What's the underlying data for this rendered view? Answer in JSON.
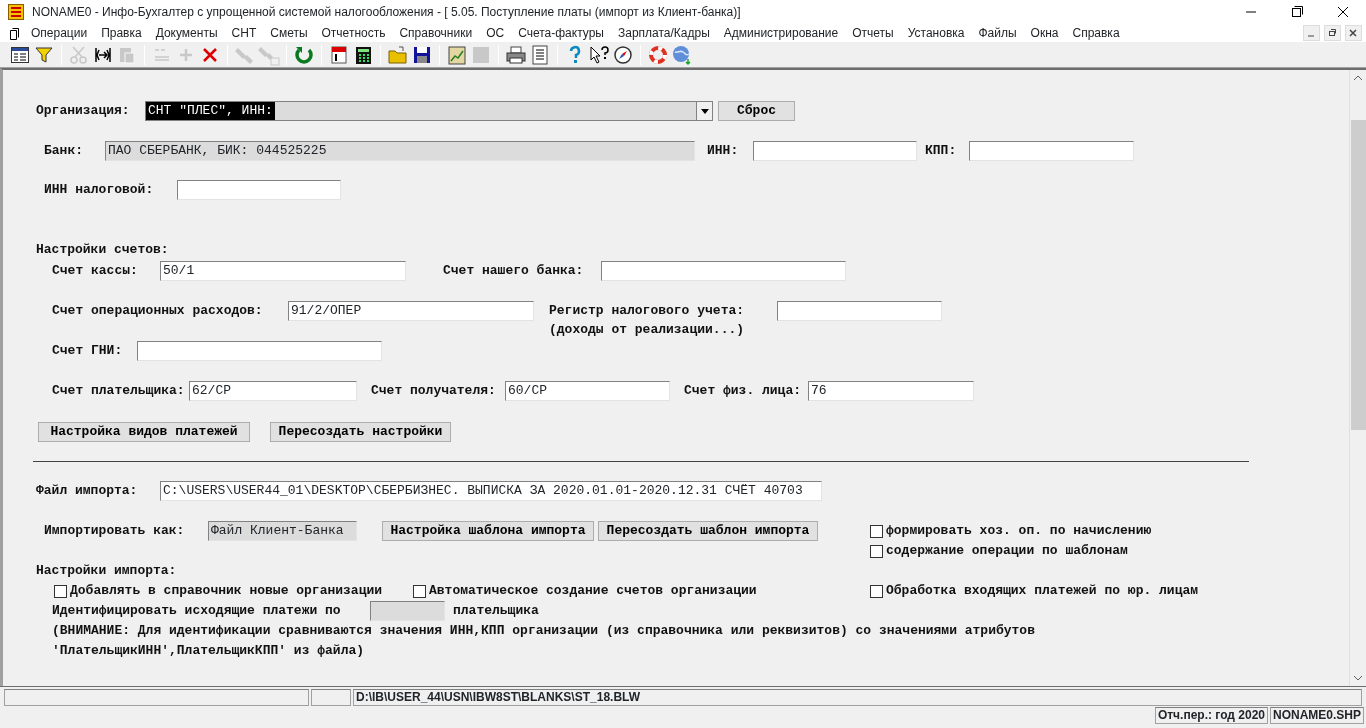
{
  "window": {
    "title": "NONAME0 - Инфо-Бухгалтер с упрощенной системой налогообложения - [ 5.05. Поступление платы (импорт из Клиент-банка)]"
  },
  "menu": [
    "Операции",
    "Правка",
    "Документы",
    "СНТ",
    "Сметы",
    "Отчетность",
    "Справочники",
    "ОС",
    "Счета-фактуры",
    "Зарплата/Кадры",
    "Администрирование",
    "Отчеты",
    "Установка",
    "Файлы",
    "Окна",
    "Справка"
  ],
  "toolbar": [
    [
      {
        "disabled": false
      },
      {
        "disabled": false
      }
    ],
    [
      {
        "disabled": true
      },
      {
        "disabled": false
      },
      {
        "disabled": true
      }
    ],
    [
      {
        "disabled": true
      },
      {
        "disabled": true
      },
      {
        "disabled": false
      }
    ],
    [
      {
        "disabled": true
      },
      {
        "disabled": true
      }
    ],
    [
      {
        "disabled": false
      }
    ],
    [
      {
        "disabled": false
      },
      {
        "disabled": false
      }
    ],
    [
      {
        "disabled": false
      },
      {
        "disabled": false
      }
    ],
    [
      {
        "disabled": false
      },
      {
        "disabled": true
      }
    ],
    [
      {
        "disabled": false
      },
      {
        "disabled": false
      }
    ],
    [
      {
        "disabled": false
      },
      {
        "disabled": false
      },
      {
        "disabled": false
      }
    ],
    [
      {
        "disabled": false
      },
      {
        "disabled": false
      }
    ]
  ],
  "form": [
    [
      {
        "kind": "label",
        "text": "Организация:"
      },
      {
        "kind": "combo",
        "value": "СНТ \"ПЛЕС\", ИНН:"
      },
      {
        "kind": "button",
        "text": "Сброс"
      }
    ],
    [
      {
        "kind": "label",
        "text": "Банк:"
      },
      {
        "kind": "field",
        "value": "ПАО СБЕРБАНК, БИК: 044525225",
        "readonly": true
      },
      {
        "kind": "label",
        "text": "ИНН:"
      },
      {
        "kind": "field",
        "readonly": false
      },
      {
        "kind": "label",
        "text": "КПП:"
      },
      {
        "kind": "field",
        "readonly": false
      }
    ],
    [
      {
        "kind": "label",
        "text": "ИНН налоговой:"
      },
      {
        "kind": "field",
        "readonly": false
      }
    ],
    [
      {
        "kind": "label",
        "text": "Настройки счетов:"
      }
    ],
    [
      {
        "kind": "label",
        "text": "Счет кассы:"
      },
      {
        "kind": "field",
        "value": "50/1",
        "readonly": false
      },
      {
        "kind": "label",
        "text": "Счет нашего банка:"
      },
      {
        "kind": "field",
        "readonly": false
      }
    ],
    [
      {
        "kind": "label",
        "text": "Счет операционных расходов:"
      },
      {
        "kind": "field",
        "value": "91/2/ОПЕР",
        "readonly": false
      },
      {
        "kind": "label",
        "text": "Регистр налогового учета:"
      },
      {
        "kind": "field",
        "readonly": false
      }
    ],
    [
      {
        "kind": "label",
        "text": "(доходы от реализации...)"
      }
    ],
    [
      {
        "kind": "label",
        "text": "Счет ГНИ:"
      },
      {
        "kind": "field",
        "readonly": false
      }
    ],
    [
      {
        "kind": "label",
        "text": "Счет плательщика:"
      },
      {
        "kind": "field",
        "value": "62/СР",
        "readonly": false
      },
      {
        "kind": "label",
        "text": "Счет получателя:"
      },
      {
        "kind": "field",
        "value": "60/СР",
        "readonly": false
      },
      {
        "kind": "label",
        "text": "Счет физ. лица:"
      },
      {
        "kind": "field",
        "value": "76",
        "readonly": false
      }
    ],
    [
      {
        "kind": "button",
        "text": "Настройка видов платежей"
      },
      {
        "kind": "button",
        "text": "Пересоздать настройки"
      }
    ],
    [
      {
        "kind": "label",
        "text": "Файл импорта:"
      },
      {
        "kind": "field",
        "value": "C:\\USERS\\USER44_01\\DESKTOP\\СБЕРБИЗНЕС. ВЫПИСКА ЗА 2020.01.01-2020.12.31 СЧЁТ 40703",
        "readonly": false
      }
    ],
    [
      {
        "kind": "label",
        "text": "Импортировать как:"
      },
      {
        "kind": "field",
        "value": "Файл Клиент-Банка",
        "readonly": true
      },
      {
        "kind": "button",
        "text": "Настройка шаблона импорта"
      },
      {
        "kind": "button",
        "text": "Пересоздать шаблон импорта"
      },
      {
        "kind": "checkbox",
        "text": "формировать хоз. оп. по начислению",
        "checked": false
      }
    ],
    [
      {
        "kind": "checkbox",
        "text": "содержание операции по шаблонам",
        "checked": false
      }
    ],
    [
      {
        "kind": "label",
        "text": "Настройки импорта:"
      }
    ],
    [
      {
        "kind": "checkbox",
        "text": "Добавлять в справочник новые организации",
        "checked": false
      },
      {
        "kind": "checkbox",
        "text": "Автоматическое создание счетов организации",
        "checked": false
      },
      {
        "kind": "checkbox",
        "text": "Обработка входящих платежей по юр. лицам",
        "checked": false
      }
    ],
    [
      {
        "kind": "label",
        "text": "Идентифицировать исходящие платежи по"
      },
      {
        "kind": "field",
        "readonly": true
      },
      {
        "kind": "label",
        "text": "плательщика"
      }
    ],
    [
      {
        "kind": "label",
        "text": "(ВНИМАНИЕ: Для идентификации сравниваются значения ИНН,КПП организации (из справочника или реквизитов) со значениями атрибутов"
      }
    ],
    [
      {
        "kind": "label",
        "text": "'ПлательщикИНН',ПлательщикКПП' из файла)"
      }
    ]
  ],
  "status_bar": [
    {
      "text": "D:\\IB\\USER_44\\USN\\IBW8ST\\BLANKS\\ST_18.BLW"
    }
  ],
  "status_bar_2": [
    {
      "text": "Отч.пер.: год 2020"
    },
    {
      "text": "NONAME0.SHP"
    }
  ]
}
